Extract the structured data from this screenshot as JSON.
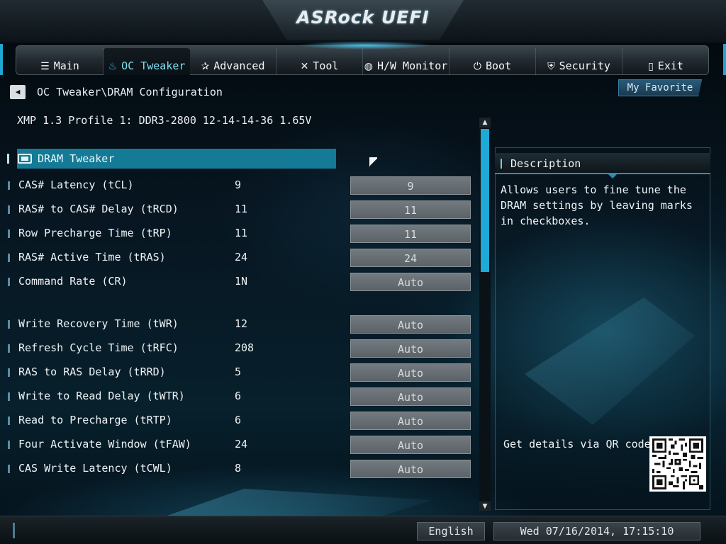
{
  "header": {
    "logo_text": "ASRock UEFI"
  },
  "tabs": [
    {
      "label": "Main",
      "icon": "list-icon",
      "glyph": "☰"
    },
    {
      "label": "OC Tweaker",
      "icon": "flame-icon",
      "glyph": "♨"
    },
    {
      "label": "Advanced",
      "icon": "star-icon",
      "glyph": "✰"
    },
    {
      "label": "Tool",
      "icon": "tools-icon",
      "glyph": "✕"
    },
    {
      "label": "H/W Monitor",
      "icon": "monitor-icon",
      "glyph": "◍"
    },
    {
      "label": "Boot",
      "icon": "power-icon",
      "glyph": "⏻"
    },
    {
      "label": "Security",
      "icon": "shield-icon",
      "glyph": "⛨"
    },
    {
      "label": "Exit",
      "icon": "door-icon",
      "glyph": "▯"
    }
  ],
  "active_tab": "OC Tweaker",
  "breadcrumb": {
    "back_glyph": "◀",
    "path": "OC Tweaker\\DRAM Configuration"
  },
  "favorite_label": "My Favorite",
  "xmp_text": "XMP 1.3 Profile 1: DDR3-2800 12-14-14-36 1.65V",
  "section": {
    "title": "DRAM Tweaker"
  },
  "settings": [
    {
      "label": "CAS# Latency (tCL)",
      "current": "9",
      "value": "9"
    },
    {
      "label": "RAS# to CAS# Delay (tRCD)",
      "current": "11",
      "value": "11"
    },
    {
      "label": "Row Precharge Time (tRP)",
      "current": "11",
      "value": "11"
    },
    {
      "label": "RAS# Active Time (tRAS)",
      "current": "24",
      "value": "24"
    },
    {
      "label": "Command Rate (CR)",
      "current": "1N",
      "value": "Auto"
    },
    {
      "label": "Write Recovery Time (tWR)",
      "current": "12",
      "value": "Auto"
    },
    {
      "label": "Refresh Cycle Time (tRFC)",
      "current": "208",
      "value": "Auto"
    },
    {
      "label": "RAS to RAS Delay (tRRD)",
      "current": "5",
      "value": "Auto"
    },
    {
      "label": "Write to Read Delay (tWTR)",
      "current": "6",
      "value": "Auto"
    },
    {
      "label": "Read to Precharge (tRTP)",
      "current": "6",
      "value": "Auto"
    },
    {
      "label": "Four Activate Window (tFAW)",
      "current": "24",
      "value": "Auto"
    },
    {
      "label": "CAS Write Latency (tCWL)",
      "current": "8",
      "value": "Auto"
    }
  ],
  "scrollbar": {
    "up_glyph": "▲",
    "down_glyph": "▼"
  },
  "description": {
    "title": "Description",
    "body": "Allows users to fine tune the DRAM settings by leaving marks in checkboxes.",
    "qr_label": "Get details via QR code"
  },
  "footer": {
    "language": "English",
    "datetime": "Wed 07/16/2014, 17:15:10"
  },
  "colors": {
    "accent": "#1ea9d6",
    "section_bg": "#157a96",
    "value_box": "#6b7378"
  }
}
